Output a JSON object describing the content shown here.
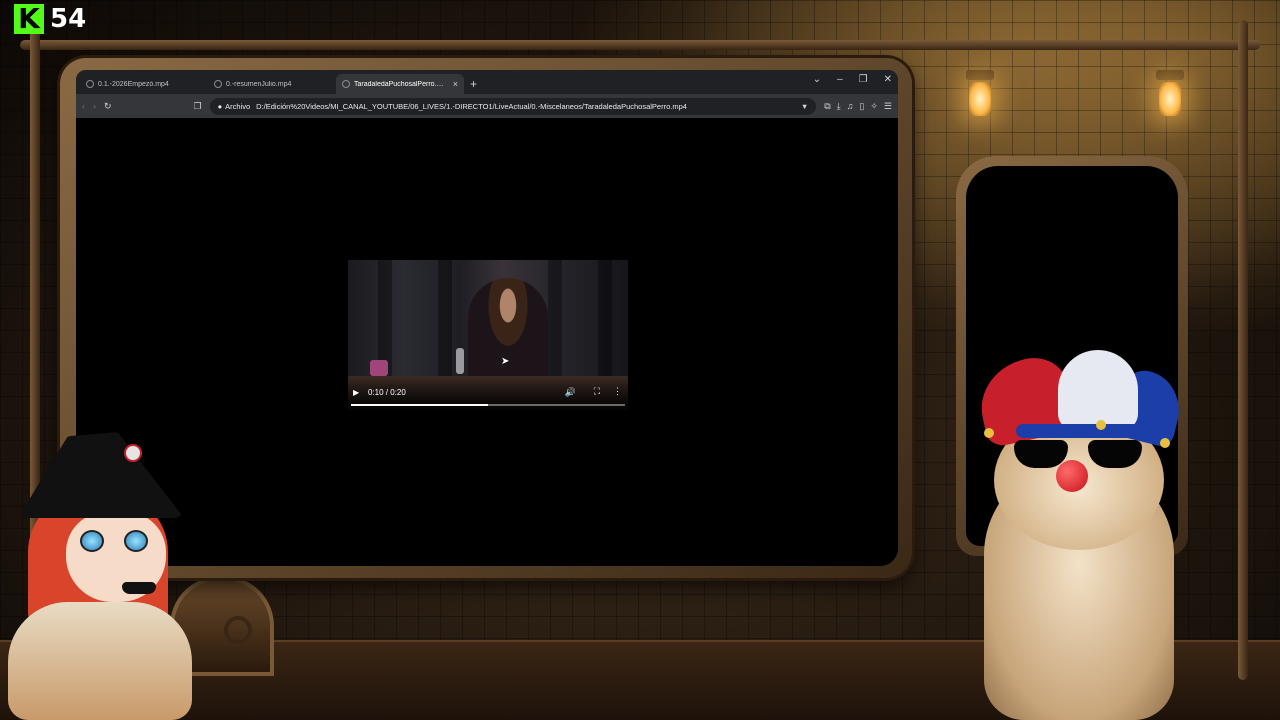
{
  "stream": {
    "platform_logo_letter": "K",
    "viewer_count": "54"
  },
  "browser": {
    "tabs": [
      {
        "label": "0.1.-2026Empezó.mp4",
        "active": false
      },
      {
        "label": "0.-resumenJulio.mp4",
        "active": false
      },
      {
        "label": "TaradaledaPuchosalPerro.mp4",
        "active": true
      }
    ],
    "new_tab_label": "+",
    "tab_close": "×",
    "window_controls": {
      "dropdown": "⌄",
      "minimize": "–",
      "restore": "❐",
      "close": "✕"
    },
    "address": {
      "scheme_chip": "Archivo",
      "url": "D:/Edición%20Videos/MI_CANAL_YOUTUBE/06_LIVES/1.-DIRECTO1/LiveActual/0.-Miscelaneos/TaradaledaPuchosalPerro.mp4"
    }
  },
  "video": {
    "time": "0:10 / 0:20",
    "progress_fraction": 0.5,
    "icons": {
      "play": "▶",
      "volume": "🔊",
      "fullscreen": "⛶",
      "more": "⋮"
    }
  },
  "colors": {
    "kick_green": "#53fc18",
    "tab_bg": "#202124",
    "toolbar_bg": "#35363a"
  }
}
